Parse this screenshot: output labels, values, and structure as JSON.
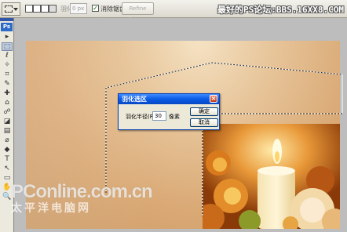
{
  "options_bar": {
    "feather_label": "羽化:",
    "feather_value": "0 px",
    "antialias_label": "消除锯齿",
    "refine_edge_label": "Refine Edge..."
  },
  "watermark_top": "最好的PS论坛:BBS.16XX8.COM",
  "toolbox": {
    "logo": "Ps",
    "tools": [
      "▸",
      "⬚",
      "ℓ",
      "✧",
      "⌗",
      "✎",
      "✚",
      "⌂",
      "☍",
      "◪",
      "▤",
      "⌀",
      "◆",
      "T",
      "↖",
      "▭",
      "✋",
      "🔍"
    ]
  },
  "dialog": {
    "title": "羽化选区",
    "close_glyph": "×",
    "field_label": "羽化半径(R):",
    "field_value": "30",
    "unit": "像素",
    "ok_label": "确定",
    "cancel_label": "取消"
  },
  "watermark_bottom": {
    "brand": "PConline.com.cn",
    "tagline": "太平洋电脑网"
  },
  "colors": {
    "title_blue": "#0a5ae6",
    "doc_tan": "#d9a874",
    "photo_orange": "#b45a12"
  }
}
